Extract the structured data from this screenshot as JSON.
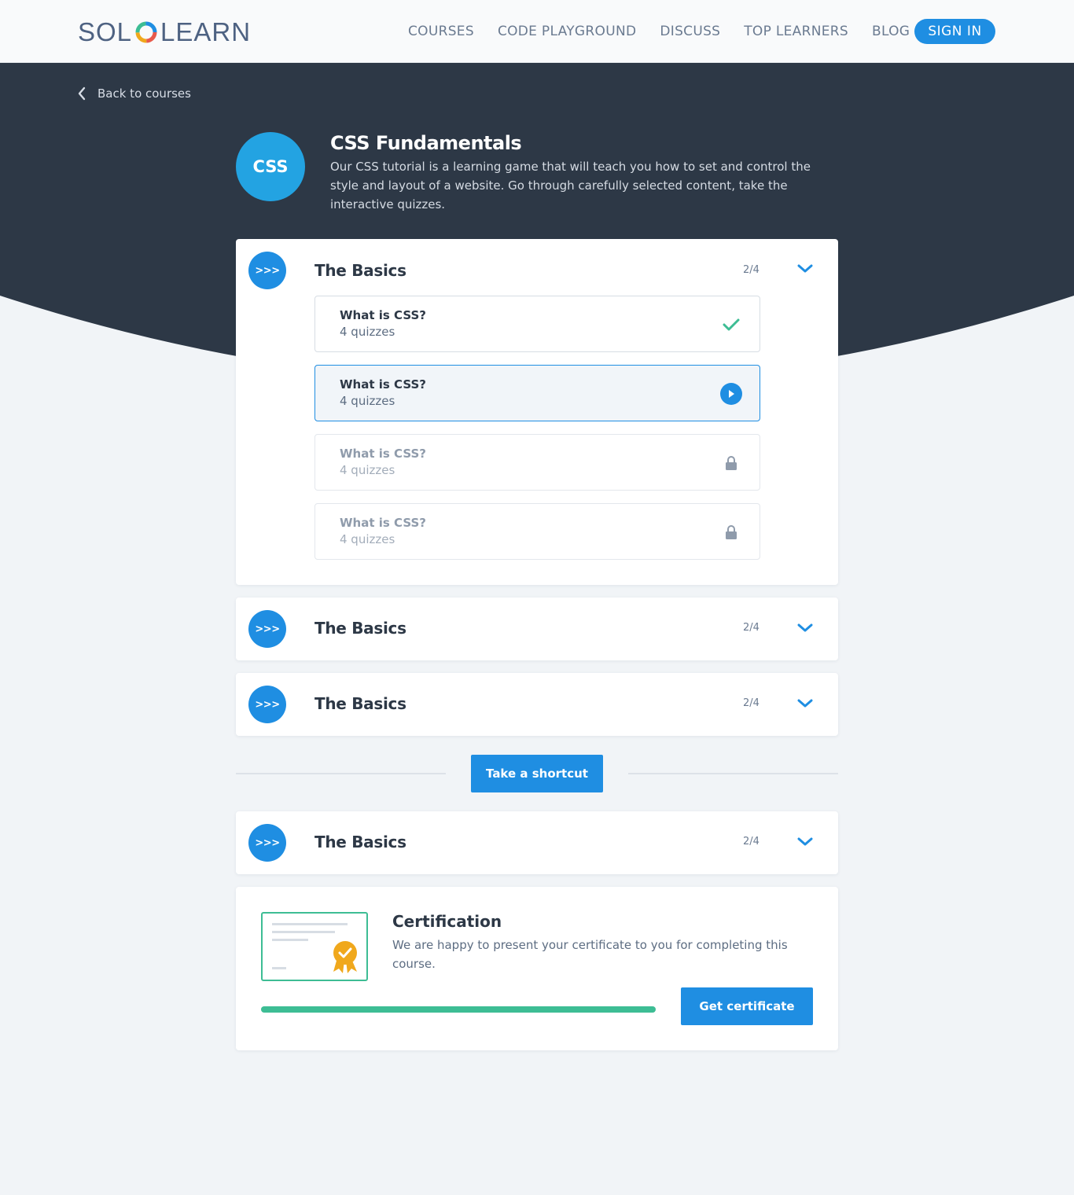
{
  "header": {
    "logo_left": "SOL",
    "logo_right": "LEARN",
    "nav": [
      "COURSES",
      "CODE PLAYGROUND",
      "DISCUSS",
      "TOP LEARNERS",
      "BLOG"
    ],
    "signin_label": "SIGN IN"
  },
  "back_label": "Back to courses",
  "course": {
    "badge": "CSS",
    "title": "CSS Fundamentals",
    "description": "Our CSS tutorial is a learning game that will teach you how to set and control the style and layout of a website. Go through carefully selected content, take the interactive quizzes."
  },
  "modules": [
    {
      "icon": ">>>",
      "title": "The Basics",
      "progress": "2/4",
      "lessons": [
        {
          "title": "What is CSS?",
          "subtitle": "4 quizzes",
          "status": "completed"
        },
        {
          "title": "What is CSS?",
          "subtitle": "4 quizzes",
          "status": "current"
        },
        {
          "title": "What is CSS?",
          "subtitle": "4 quizzes",
          "status": "locked"
        },
        {
          "title": "What is CSS?",
          "subtitle": "4 quizzes",
          "status": "locked"
        }
      ]
    },
    {
      "icon": ">>>",
      "title": "The Basics",
      "progress": "2/4"
    },
    {
      "icon": ">>>",
      "title": "The Basics",
      "progress": "2/4"
    },
    {
      "icon": ">>>",
      "title": "The Basics",
      "progress": "2/4"
    }
  ],
  "shortcut_label": "Take a shortcut",
  "certification": {
    "title": "Certification",
    "description": "We are happy to present your certificate to you for completing this course.",
    "progress": 1.0,
    "button_label": "Get certificate"
  },
  "colors": {
    "brand_blue": "#1f8ee2",
    "dark_band": "#2d3846",
    "success_green": "#3dbd94",
    "ribbon": "#f0a81c"
  }
}
